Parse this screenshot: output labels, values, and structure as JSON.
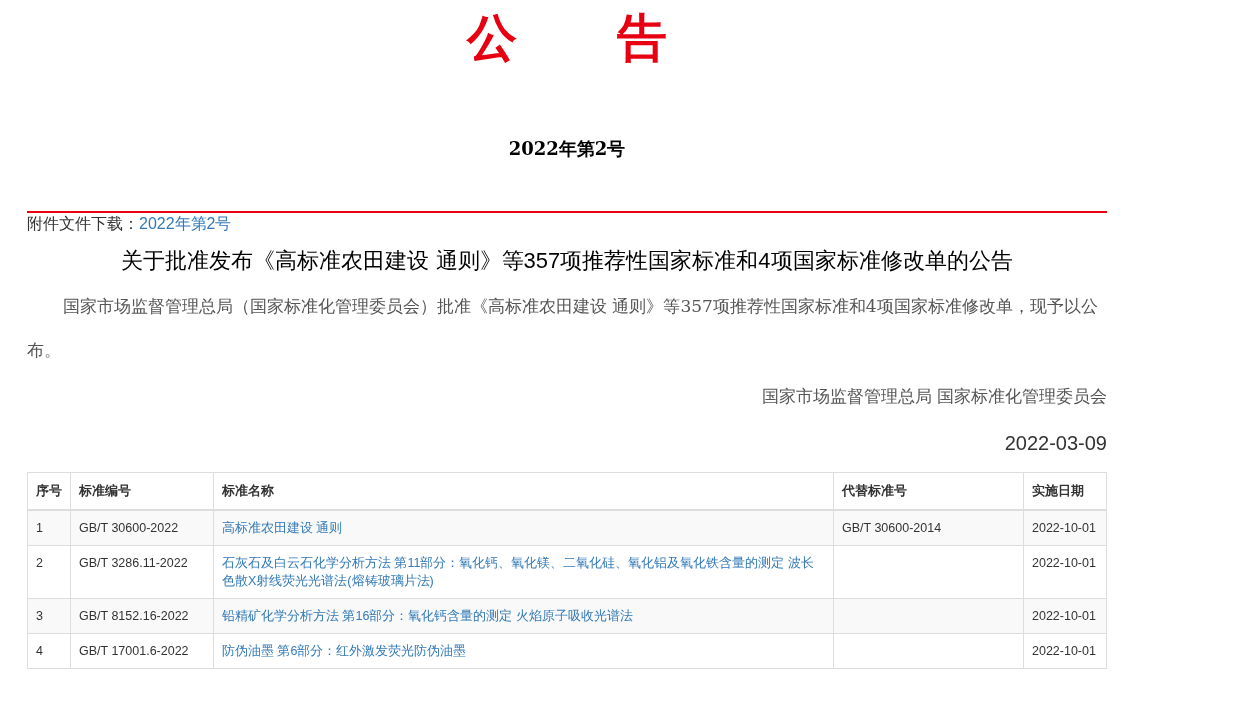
{
  "title": "公　　告",
  "issue_number": "2022年第2号",
  "attachment": {
    "label": "附件文件下载：",
    "link": "2022年第2号"
  },
  "heading": "关于批准发布《高标准农田建设 通则》等357项推荐性国家标准和4项国家标准修改单的公告",
  "body": "国家市场监督管理总局（国家标准化管理委员会）批准《高标准农田建设 通则》等357项推荐性国家标准和4项国家标准修改单，现予以公布。",
  "signature": "国家市场监督管理总局 国家标准化管理委员会",
  "date": "2022-03-09",
  "table": {
    "columns": [
      "序号",
      "标准编号",
      "标准名称",
      "代替标准号",
      "实施日期"
    ],
    "rows": [
      {
        "no": "1",
        "code": "GB/T 30600-2022",
        "name": "高标准农田建设 通则",
        "replaces": "GB/T 30600-2014",
        "effective": "2022-10-01"
      },
      {
        "no": "2",
        "code": "GB/T 3286.11-2022",
        "name": "石灰石及白云石化学分析方法 第11部分：氧化钙、氧化镁、二氧化硅、氧化铝及氧化铁含量的测定 波长色散X射线荧光光谱法(熔铸玻璃片法)",
        "effective": "2022-10-01"
      },
      {
        "no": "3",
        "code": "GB/T 8152.16-2022",
        "name": "铅精矿化学分析方法 第16部分：氧化钙含量的测定 火焰原子吸收光谱法",
        "effective": "2022-10-01"
      },
      {
        "no": "4",
        "code": "GB/T 17001.6-2022",
        "name": "防伪油墨 第6部分：红外激发荧光防伪油墨",
        "effective": "2022-10-01"
      }
    ]
  }
}
